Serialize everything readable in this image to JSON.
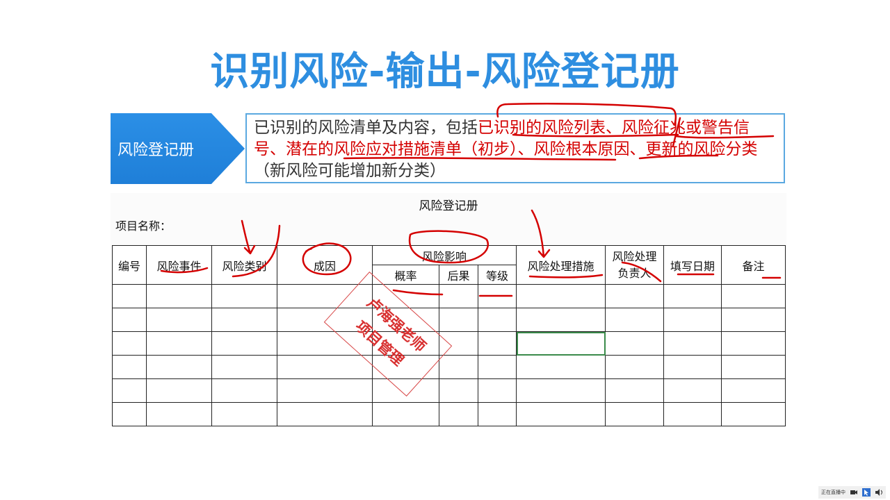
{
  "slide": {
    "title": "识别风险-输出-风险登记册",
    "label": "风险登记册",
    "description": {
      "intro": "已识别的风险清单及内容，包括",
      "item1": "已识别的风险列表、风险征兆或警告信号、潜在的风险应对措施清单（初步）、风险根本原因、更新的风险分类",
      "note": "（新风险可能增加新分类）"
    },
    "accent_color": "#2e8ee0",
    "annotation_color": "#d40000"
  },
  "register": {
    "title": "风险登记册",
    "project_name_label": "项目名称：",
    "headers": {
      "id": "编号",
      "event": "风险事件",
      "category": "风险类别",
      "cause": "成因",
      "impact": "风险影响",
      "probability": "概率",
      "consequence": "后果",
      "level": "等级",
      "response": "风险处理措施",
      "owner_line1": "风险处理",
      "owner_line2": "负责人",
      "date": "填写日期",
      "remark": "备注"
    },
    "empty_rows": 6
  },
  "stamp": {
    "line1": "卢海强老师",
    "line2": "项目管理"
  },
  "status_bar": {
    "text": "正在直播中"
  }
}
